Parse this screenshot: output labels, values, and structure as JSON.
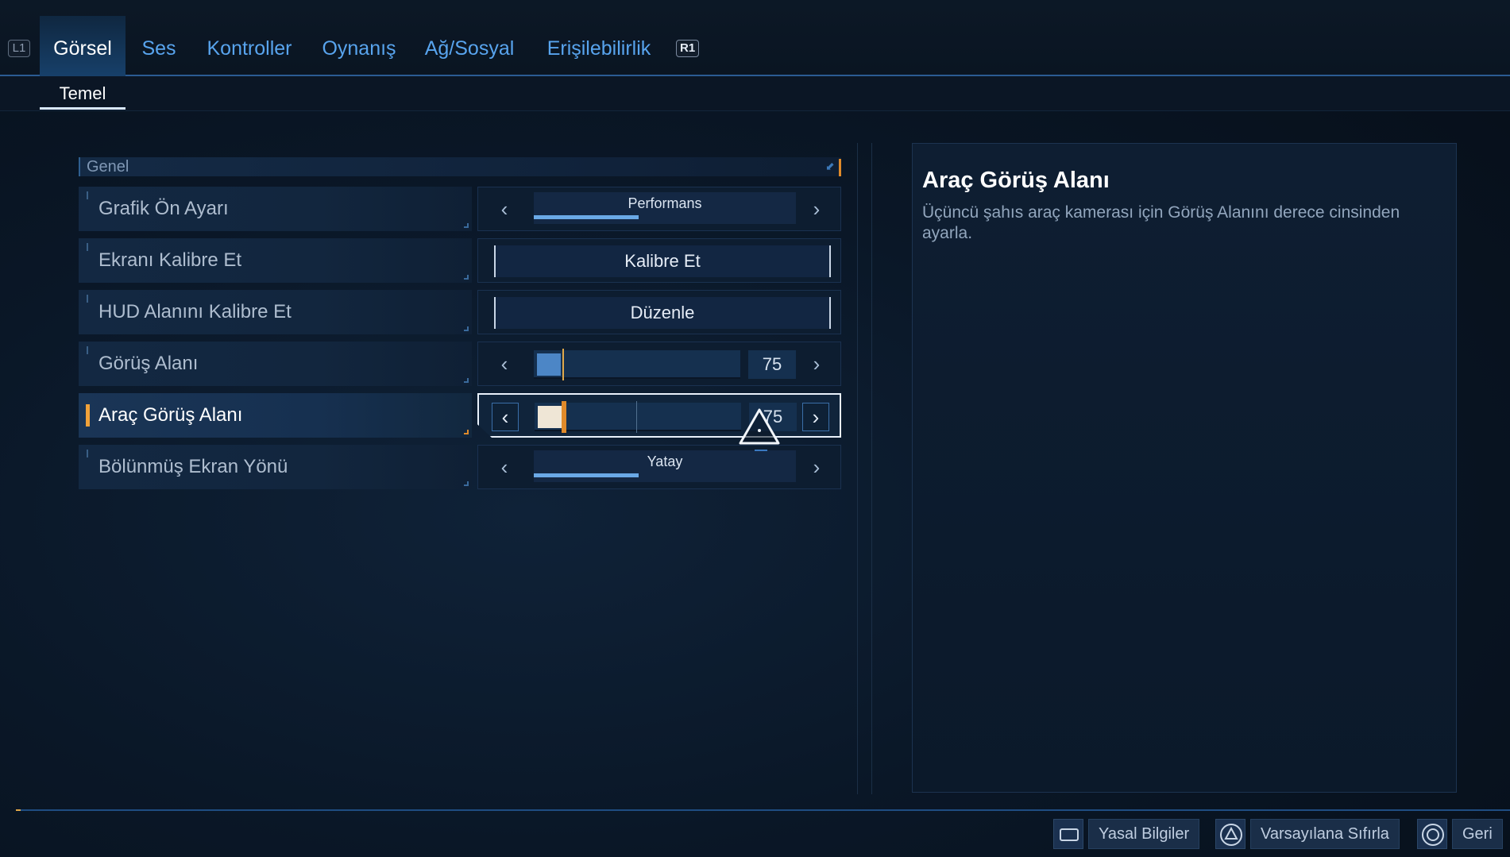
{
  "tabs": {
    "left_bumper": "L1",
    "right_bumper": "R1",
    "items": [
      {
        "label": "Görsel",
        "active": true
      },
      {
        "label": "Ses",
        "active": false
      },
      {
        "label": "Kontroller",
        "active": false
      },
      {
        "label": "Oynanış",
        "active": false
      },
      {
        "label": "Ağ/Sosyal",
        "active": false
      },
      {
        "label": "Erişilebilirlik",
        "active": false
      }
    ]
  },
  "subtabs": {
    "active": "Temel"
  },
  "section": {
    "title": "Genel"
  },
  "settings": [
    {
      "label": "Grafik Ön Ayarı",
      "type": "select",
      "value": "Performans",
      "fill": 0.4
    },
    {
      "label": "Ekranı Kalibre Et",
      "type": "button",
      "value": "Kalibre Et"
    },
    {
      "label": "HUD Alanını Kalibre Et",
      "type": "button",
      "value": "Düzenle"
    },
    {
      "label": "Görüş Alanı",
      "type": "slider",
      "value": "75"
    },
    {
      "label": "Araç Görüş Alanı",
      "type": "slider",
      "value": "75",
      "selected": true
    },
    {
      "label": "Bölünmüş Ekran Yönü",
      "type": "select",
      "value": "Yatay",
      "fill": 0.4
    }
  ],
  "description": {
    "title": "Araç Görüş Alanı",
    "text": "Üçüncü şahıs araç kamerası için Görüş Alanını derece cinsinden ayarla."
  },
  "footer": {
    "actions": [
      {
        "label": "Yasal Bilgiler",
        "icon": "touchpad-icon"
      },
      {
        "label": "Varsayılana Sıfırla",
        "icon": "triangle-button-icon"
      },
      {
        "label": "Geri",
        "icon": "circle-button-icon"
      }
    ]
  },
  "colors": {
    "accent": "#58a4ee",
    "highlight": "#e08a2a",
    "background": "#0a1727"
  }
}
